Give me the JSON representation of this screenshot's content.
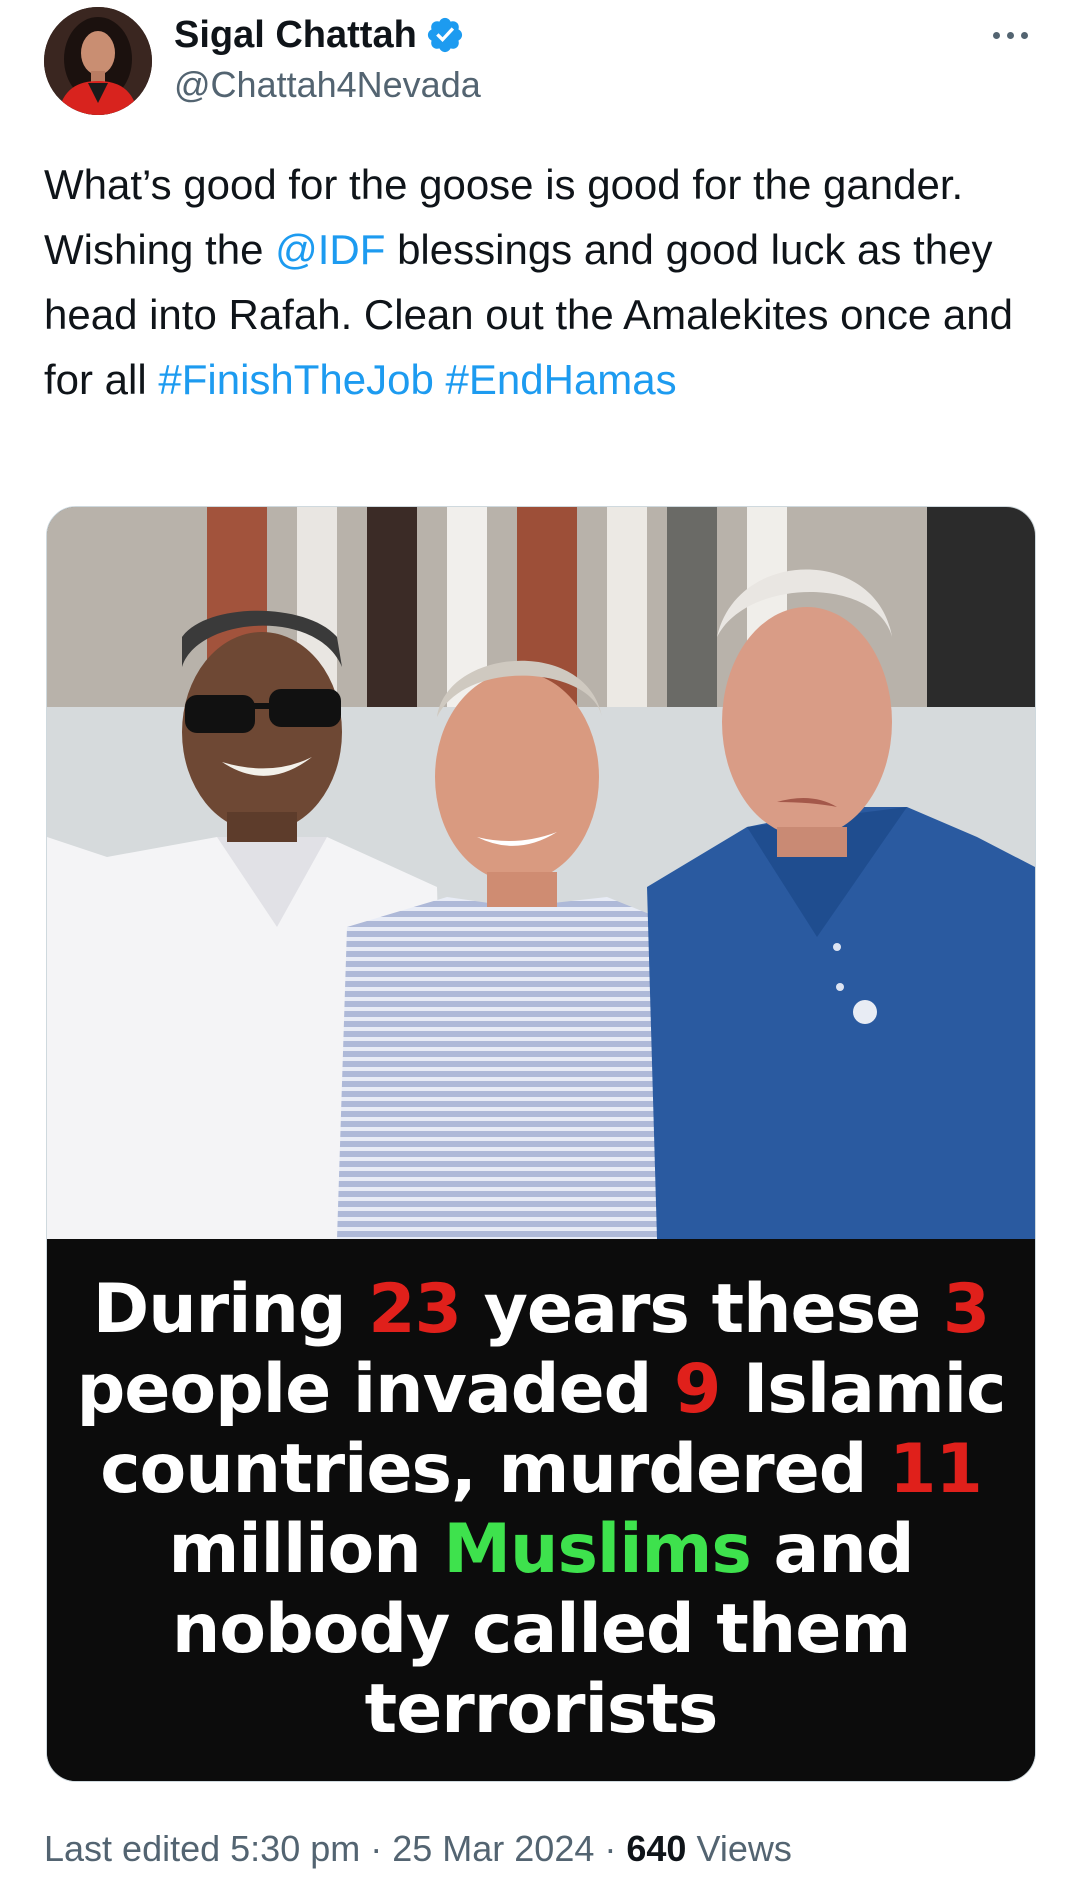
{
  "author": {
    "display_name": "Sigal Chattah",
    "handle": "@Chattah4Nevada",
    "verified_color": "#1d9bf0"
  },
  "tweet": {
    "text_parts": {
      "p1": "What’s good for the goose is good for the gander. Wishing the ",
      "mention": "@IDF",
      "p2": " blessings and good luck as they head into Rafah. Clean out the Amalekites once and for all ",
      "hashtag1": "#FinishTheJob",
      "space": " ",
      "hashtag2": "#EndHamas"
    },
    "link_color": "#1d9bf0"
  },
  "media": {
    "caption": {
      "line1": {
        "a": "During ",
        "n1": "23",
        "b": " years these ",
        "n2": "3"
      },
      "line2": {
        "a": "people invaded ",
        "n1": "9",
        "b": " Islamic"
      },
      "line3": {
        "a": "countries, murdered ",
        "n1": "11"
      },
      "line4": {
        "a": "million ",
        "hl": "Muslims",
        "b": " and"
      },
      "line5": {
        "a": "nobody called them"
      },
      "line6": {
        "a": "terrorists"
      }
    },
    "highlight_red": "#e0201b",
    "highlight_green": "#3ee24d"
  },
  "footer": {
    "edited_label": "Last edited",
    "time": "5:30 pm",
    "sep1": " · ",
    "date": "25 Mar 2024",
    "sep2": " · ",
    "views_count": "640",
    "views_label": " Views"
  },
  "icons": {
    "verified": "verified-badge-icon",
    "more": "more-options-icon"
  }
}
